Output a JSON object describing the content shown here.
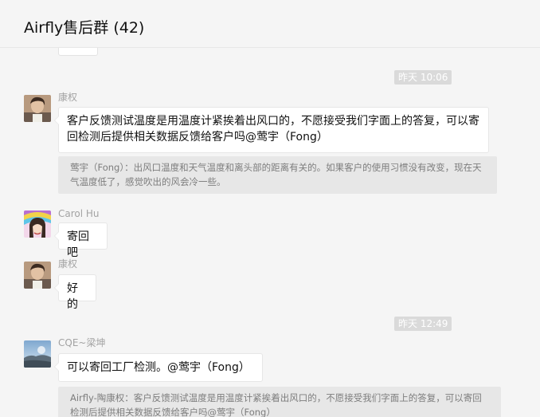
{
  "header": {
    "title": "Airfly售后群 (42)"
  },
  "messages": [
    {
      "type": "time",
      "text": "昨天 10:06"
    },
    {
      "type": "message",
      "sender": "康权",
      "avatar": "kangquan-avatar",
      "text": "客户反馈测试温度是用温度计紧挨着出风口的，不愿接受我们字面上的答复，可以寄回检测后提供相关数据反馈给客户吗@莺宇（Fong）"
    },
    {
      "type": "quote",
      "text": "莺宇（Fong）：出风口温度和天气温度和离头部的距离有关的。如果客户的使用习惯没有改变，现在天气温度低了，感觉吹出的风会冷一些。"
    },
    {
      "type": "message",
      "sender": "Carol Hu",
      "avatar": "carolhu-avatar",
      "text": "寄回吧"
    },
    {
      "type": "message",
      "sender": "康权",
      "avatar": "kangquan-avatar",
      "text": "好的"
    },
    {
      "type": "time",
      "text": "昨天 12:49"
    },
    {
      "type": "message",
      "sender": "CQE~梁坤",
      "avatar": "cqe-avatar",
      "text": "可以寄回工厂检测。@莺宇（Fong）"
    },
    {
      "type": "quote",
      "text": "Airfly-陶康权：客户反馈测试温度是用温度计紧挨着出风口的，不愿接受我们字面上的答复，可以寄回检测后提供相关数据反馈给客户吗@莺宇（Fong）"
    }
  ],
  "colors": {
    "background": "#f5f5f5",
    "bubble": "#ffffff",
    "quote_background": "#e7e7e7",
    "time_badge": "#dadada",
    "sender_name": "#a3a3a3"
  }
}
